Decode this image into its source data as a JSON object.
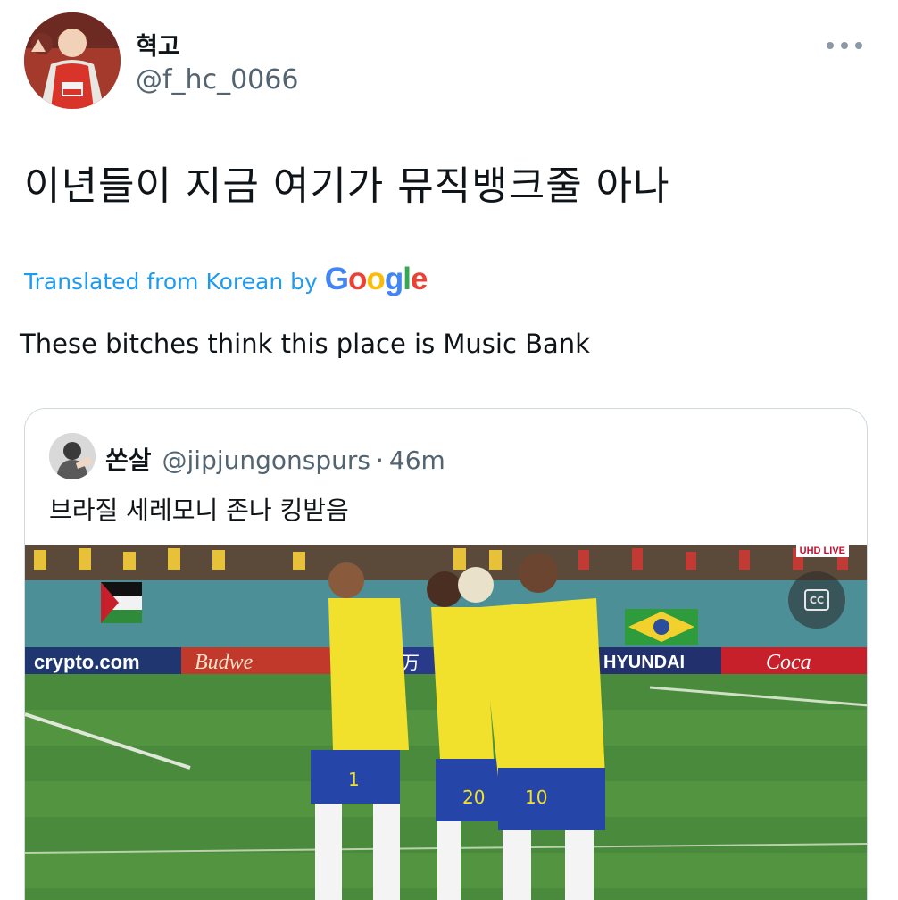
{
  "author": {
    "display_name": "혁고",
    "handle": "@f_hc_0066",
    "avatar_icon": "profile-avatar"
  },
  "tweet": {
    "text": "이년들이 지금 여기가 뮤직뱅크줄 아나",
    "translated_label": "Translated from Korean by",
    "translation_provider": "Google",
    "translation": "These bitches think this place is Music Bank"
  },
  "quoted_tweet": {
    "display_name": "쏜살",
    "handle": "@jipjungonspurs",
    "separator": "·",
    "time": "46m",
    "text": "브라질 세레모니 존나 킹받음",
    "media": {
      "board_left": "crypto.com",
      "board_budweiser": "Budwe",
      "board_chinese": "万",
      "board_hyundai": "HYUNDAI",
      "board_coke": "Coca",
      "badge": "UHD LIVE",
      "jersey_numbers": [
        "1",
        "20",
        "10"
      ]
    }
  },
  "colors": {
    "link_blue": "#1d9bf0",
    "secondary_text": "#536471",
    "border": "#cfd9de"
  }
}
